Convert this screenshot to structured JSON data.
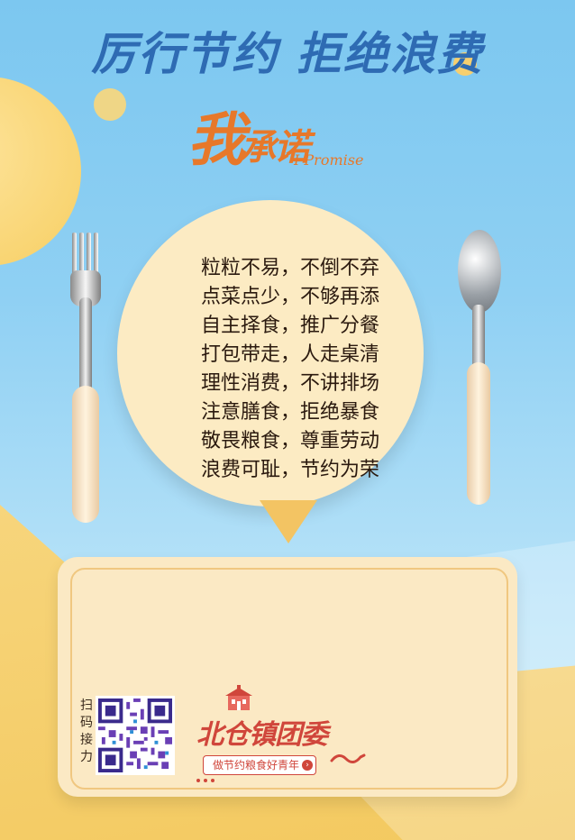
{
  "title": "厉行节约 拒绝浪费",
  "promise": {
    "cn_main": "我",
    "cn_rest": "承诺",
    "en": "I Promise"
  },
  "pledge_lines": [
    "粒粒不易，不倒不弃",
    "点菜点少，不够再添",
    "自主择食，推广分餐",
    "打包带走，人走桌清",
    "理性消费，不讲排场",
    "注意膳食，拒绝暴食",
    "敬畏粮食，尊重劳动",
    "浪费可耻，节约为荣"
  ],
  "card": {
    "scan_label": "扫码接力",
    "org_name": "北仓镇团委",
    "slogan": "做节约粮食好青年"
  },
  "colors": {
    "title": "#2e6bb3",
    "accent_orange": "#e7782a",
    "org_red": "#d0463b",
    "circle": "#fcebc3"
  }
}
